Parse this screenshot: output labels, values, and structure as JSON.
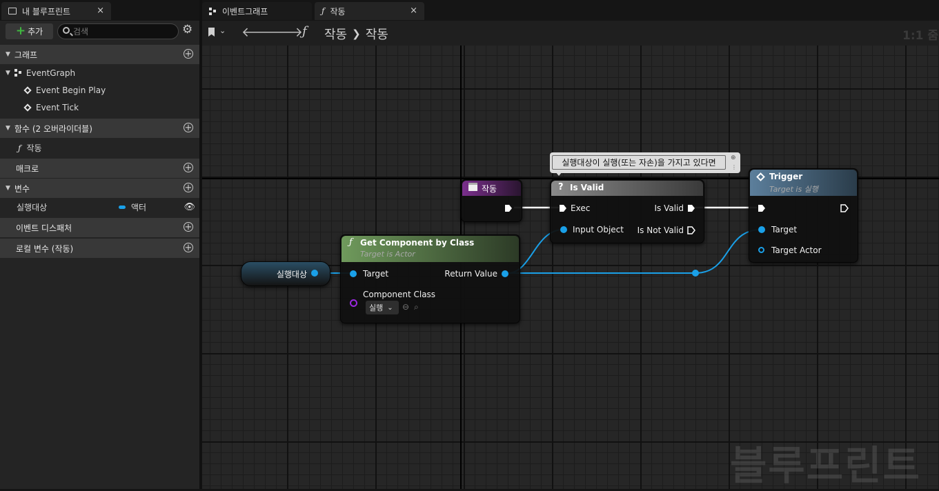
{
  "tabs": {
    "blueprint_tab": "내 블루프린트",
    "event_graph_tab": "이벤트그래프",
    "function_tab": "작동",
    "close_glyph": "×"
  },
  "left_toolbar": {
    "add_label": "추가",
    "search_placeholder": "검색"
  },
  "sections": {
    "graphs": "그래프",
    "functions": "함수 (2 오버라이더블)",
    "macros": "매크로",
    "variables": "변수",
    "event_dispatchers": "이벤트 디스패처",
    "local_variables": "로컬 변수 (작동)"
  },
  "tree": {
    "event_graph": "EventGraph",
    "event_begin_play": "Event Begin Play",
    "event_tick": "Event Tick",
    "function_item": "작동",
    "variable_name": "실행대상",
    "variable_type": "액터"
  },
  "graph_toolbar": {
    "breadcrumb_1": "작동",
    "breadcrumb_2": "작동",
    "zoom": "1:1 줌"
  },
  "comment": {
    "text": "실행대상이 실행(또는 자손)을 가지고 있다면"
  },
  "nodes": {
    "entry": {
      "title": "작동"
    },
    "is_valid": {
      "title": "Is Valid",
      "exec": "Exec",
      "input_object": "Input Object",
      "is_valid_out": "Is Valid",
      "is_not_valid_out": "Is Not Valid"
    },
    "trigger": {
      "title": "Trigger",
      "subtitle": "Target is 실행",
      "target": "Target",
      "target_actor": "Target Actor"
    },
    "get_component": {
      "title": "Get Component by Class",
      "subtitle": "Target is Actor",
      "target": "Target",
      "return_value": "Return Value",
      "component_class": "Component Class",
      "class_value": "실행"
    },
    "variable_get": {
      "label": "실행대상"
    }
  },
  "watermark": "블루프린트",
  "colors": {
    "object_pin": "#1aa0e8",
    "class_pin": "#9a28e0",
    "function_header": "#6a8a58",
    "event_header": "#5a7a9a",
    "entry_header": "#6b2a7a"
  }
}
